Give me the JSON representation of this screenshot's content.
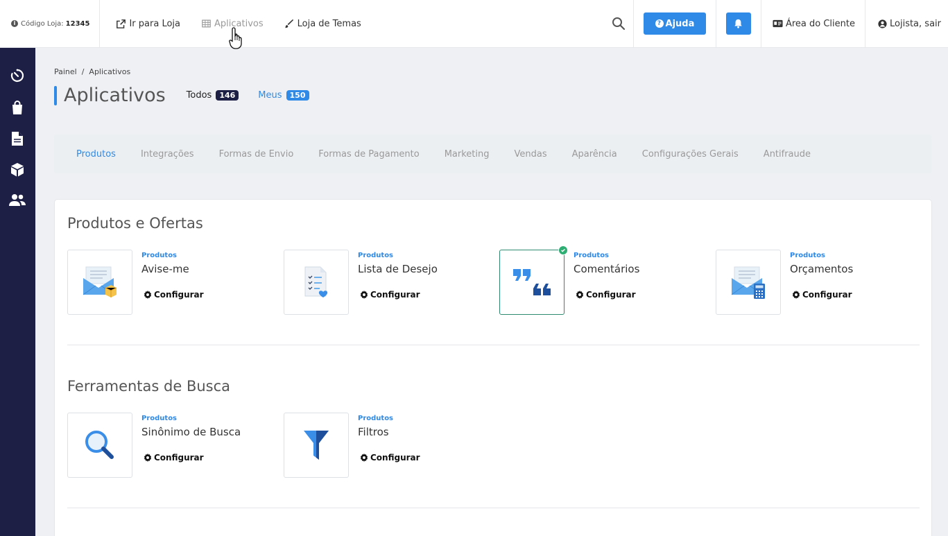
{
  "topbar": {
    "store_code_label": "Código Loja:",
    "store_code_value": "12345",
    "nav": [
      {
        "label": "Ir para Loja",
        "icon": "external-link-icon"
      },
      {
        "label": "Aplicativos",
        "icon": "grid-icon"
      },
      {
        "label": "Loja de Temas",
        "icon": "brush-icon"
      }
    ],
    "help_label": "Ajuda",
    "client_area_label": "Área do Cliente",
    "logout_label": "Lojista, sair"
  },
  "sidebar": {
    "icons": [
      "dashboard-icon",
      "bag-icon",
      "document-icon",
      "box-icon",
      "users-icon"
    ]
  },
  "breadcrumb": "Painel  /  Aplicativos",
  "page": {
    "title": "Aplicativos",
    "filters": [
      {
        "label": "Todos",
        "count": "146"
      },
      {
        "label": "Meus",
        "count": "150"
      }
    ]
  },
  "categories": [
    "Produtos",
    "Integrações",
    "Formas de Envio",
    "Formas de Pagamento",
    "Marketing",
    "Vendas",
    "Aparência",
    "Configurações Gerais",
    "Antifraude"
  ],
  "sections": [
    {
      "title": "Produtos e Ofertas",
      "apps": [
        {
          "category": "Produtos",
          "name": "Avise-me",
          "config": "Configurar",
          "icon": "envelope-box-icon",
          "installed": false
        },
        {
          "category": "Produtos",
          "name": "Lista de Desejo",
          "config": "Configurar",
          "icon": "wishlist-icon",
          "installed": false
        },
        {
          "category": "Produtos",
          "name": "Comentários",
          "config": "Configurar",
          "icon": "quote-icon",
          "installed": true
        },
        {
          "category": "Produtos",
          "name": "Orçamentos",
          "config": "Configurar",
          "icon": "envelope-calculator-icon",
          "installed": false
        }
      ]
    },
    {
      "title": "Ferramentas de Busca",
      "apps": [
        {
          "category": "Produtos",
          "name": "Sinônimo de Busca",
          "config": "Configurar",
          "icon": "magnifier-icon",
          "installed": false
        },
        {
          "category": "Produtos",
          "name": "Filtros",
          "config": "Configurar",
          "icon": "funnel-icon",
          "installed": false
        }
      ]
    }
  ],
  "colors": {
    "accent": "#2e8ae6",
    "sidebar": "#1e1f45",
    "installed": "#2fae73"
  }
}
